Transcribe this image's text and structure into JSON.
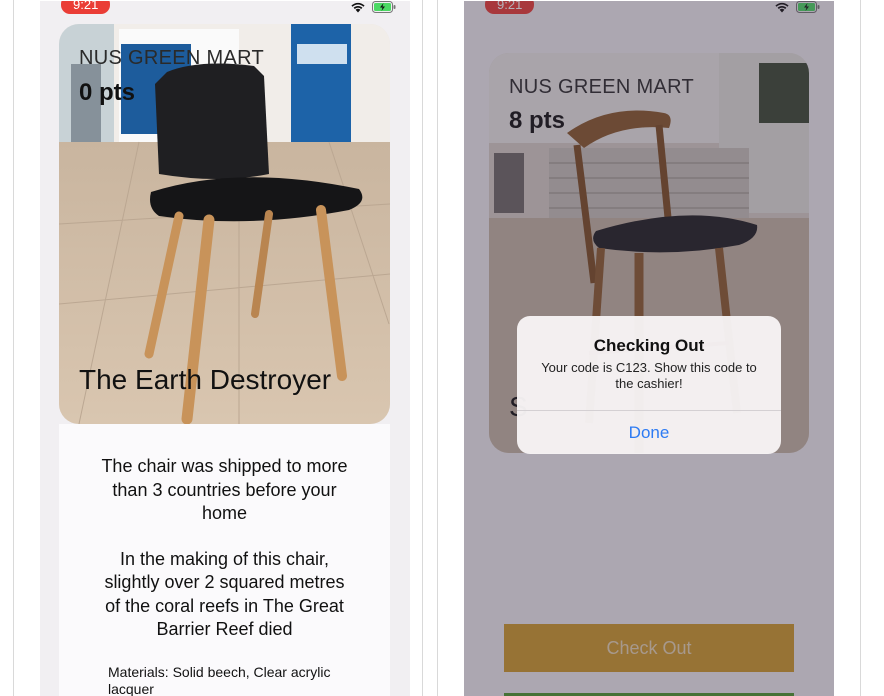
{
  "left_phone": {
    "status": {
      "time": "9:21",
      "wifi_icon": "wifi-icon",
      "battery_icon": "battery-charging-icon"
    },
    "card": {
      "store": "NUS GREEN MART",
      "points": "0 pts",
      "product_name": "The Earth Destroyer"
    },
    "description": {
      "fact_1": "The chair was shipped to more than 3 countries before your home",
      "fact_2": "In the making of this chair, slightly over 2 squared metres of the coral reefs in The Great Barrier Reef died",
      "materials": "Materials: Solid beech, Clear acrylic lacquer"
    }
  },
  "right_phone": {
    "status": {
      "time": "9:21",
      "wifi_icon": "wifi-icon",
      "battery_icon": "battery-charging-icon"
    },
    "card": {
      "store": "NUS GREEN MART",
      "points": "8 pts",
      "product_name_partial": "S"
    },
    "alert": {
      "title": "Checking Out",
      "message": "Your code is C123. Show this code to the cashier!",
      "button": "Done"
    },
    "checkout_button": "Check Out"
  },
  "colors": {
    "status_pill": "#ea3d36",
    "checkout": "#cf9b2a",
    "alert_button": "#2d7bf3",
    "green_button": "#4c9a2c"
  }
}
